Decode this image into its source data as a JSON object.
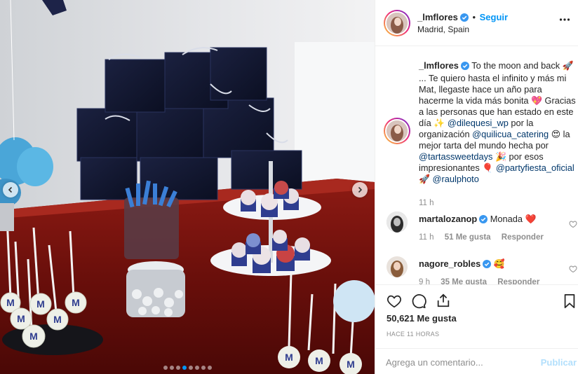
{
  "post": {
    "author": "_lmflores",
    "follow_label": "Seguir",
    "separator": "•",
    "location": "Madrid, Spain",
    "more_icon": "more-horizontal-icon"
  },
  "media": {
    "carousel_dots": 8,
    "active_dot": 3,
    "photo_description_icons": [
      "cake-pop-icon",
      "gift-box-icon",
      "cupcake-stand-icon"
    ]
  },
  "caption": {
    "username": "_lmflores",
    "parts": [
      {
        "type": "text",
        "value": "To the moon and back 🚀 ... Te quiero hasta el infinito y más mi Mat, llegaste hace un año para hacerme la vida más bonita 💖 Gracias a las personas que han estado en este día ✨ "
      },
      {
        "type": "mention",
        "value": "@dilequesi_wp"
      },
      {
        "type": "text",
        "value": " por la organización "
      },
      {
        "type": "mention",
        "value": "@quilicua_catering"
      },
      {
        "type": "text",
        "value": " 😍 la mejor tarta del mundo hecha por "
      },
      {
        "type": "mention",
        "value": "@tartassweetdays"
      },
      {
        "type": "text",
        "value": " 🎉 por esos impresionantes 🎈 "
      },
      {
        "type": "mention",
        "value": "@partyfiesta_oficial"
      },
      {
        "type": "text",
        "value": " 🚀 "
      },
      {
        "type": "mention",
        "value": "@raulphoto"
      }
    ],
    "time": "11 h"
  },
  "comments": [
    {
      "username": "martalozanop",
      "text": "Monada ❤️",
      "time": "11 h",
      "likes": "51 Me gusta",
      "reply": "Responder"
    },
    {
      "username": "nagore_robles",
      "text": "🥰",
      "time": "9 h",
      "likes": "35 Me gusta",
      "reply": "Responder"
    }
  ],
  "actions": {
    "likes": "50,621 Me gusta",
    "timestamp": "HACE 11 HORAS"
  },
  "composer": {
    "placeholder": "Agrega un comentario...",
    "publish": "Publicar"
  },
  "colors": {
    "accent": "#0095f6",
    "verified": "#3897f0",
    "publish_disabled": "#b2dffc",
    "tag": "#00376b",
    "muted": "#8e8e8e"
  }
}
